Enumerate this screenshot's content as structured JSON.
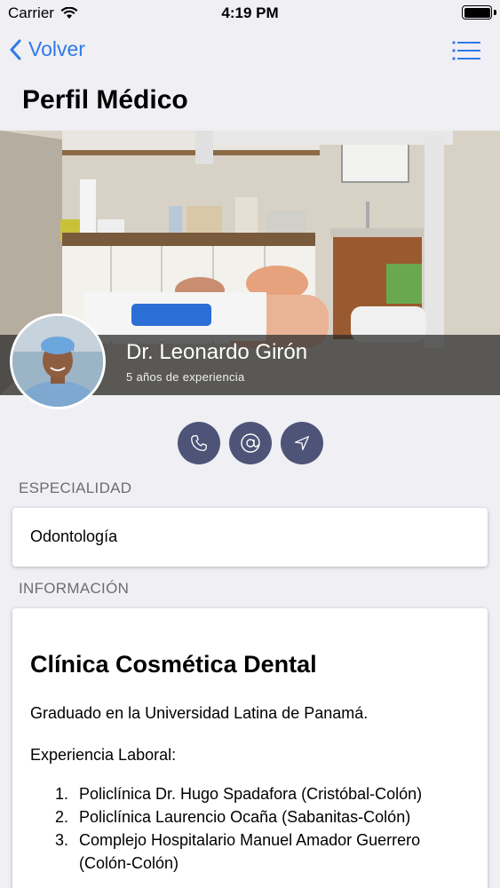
{
  "status_bar": {
    "carrier": "Carrier",
    "time": "4:19 PM"
  },
  "nav": {
    "back_label": "Volver",
    "menu_icon": "list-icon"
  },
  "page": {
    "title": "Perfil Médico"
  },
  "profile": {
    "name": "Dr. Leonardo Girón",
    "experience": "5 años de experiencia"
  },
  "actions": [
    {
      "name": "call",
      "icon": "phone-icon"
    },
    {
      "name": "email",
      "icon": "at-sign-icon"
    },
    {
      "name": "directions",
      "icon": "location-arrow-icon"
    }
  ],
  "specialty": {
    "header": "ESPECIALIDAD",
    "value": "Odontología"
  },
  "information": {
    "header": "INFORMACIÓN",
    "clinic": "Clínica Cosmética Dental",
    "education": "Graduado en la Universidad Latina de Panamá.",
    "experience_title": "Experiencia Laboral:",
    "experience_items": [
      {
        "num": "1.",
        "text": "Policlínica Dr. Hugo Spadafora (Cristóbal-Colón)"
      },
      {
        "num": "2.",
        "text": "Policlínica Laurencio Ocaña (Sabanitas-Colón)"
      },
      {
        "num": "3.",
        "text": "Complejo Hospitalario Manuel Amador Guerrero (Colón-Colón)"
      }
    ]
  },
  "colors": {
    "accent": "#2f7ae6",
    "action_button": "#4e5478",
    "background": "#efeff4"
  }
}
